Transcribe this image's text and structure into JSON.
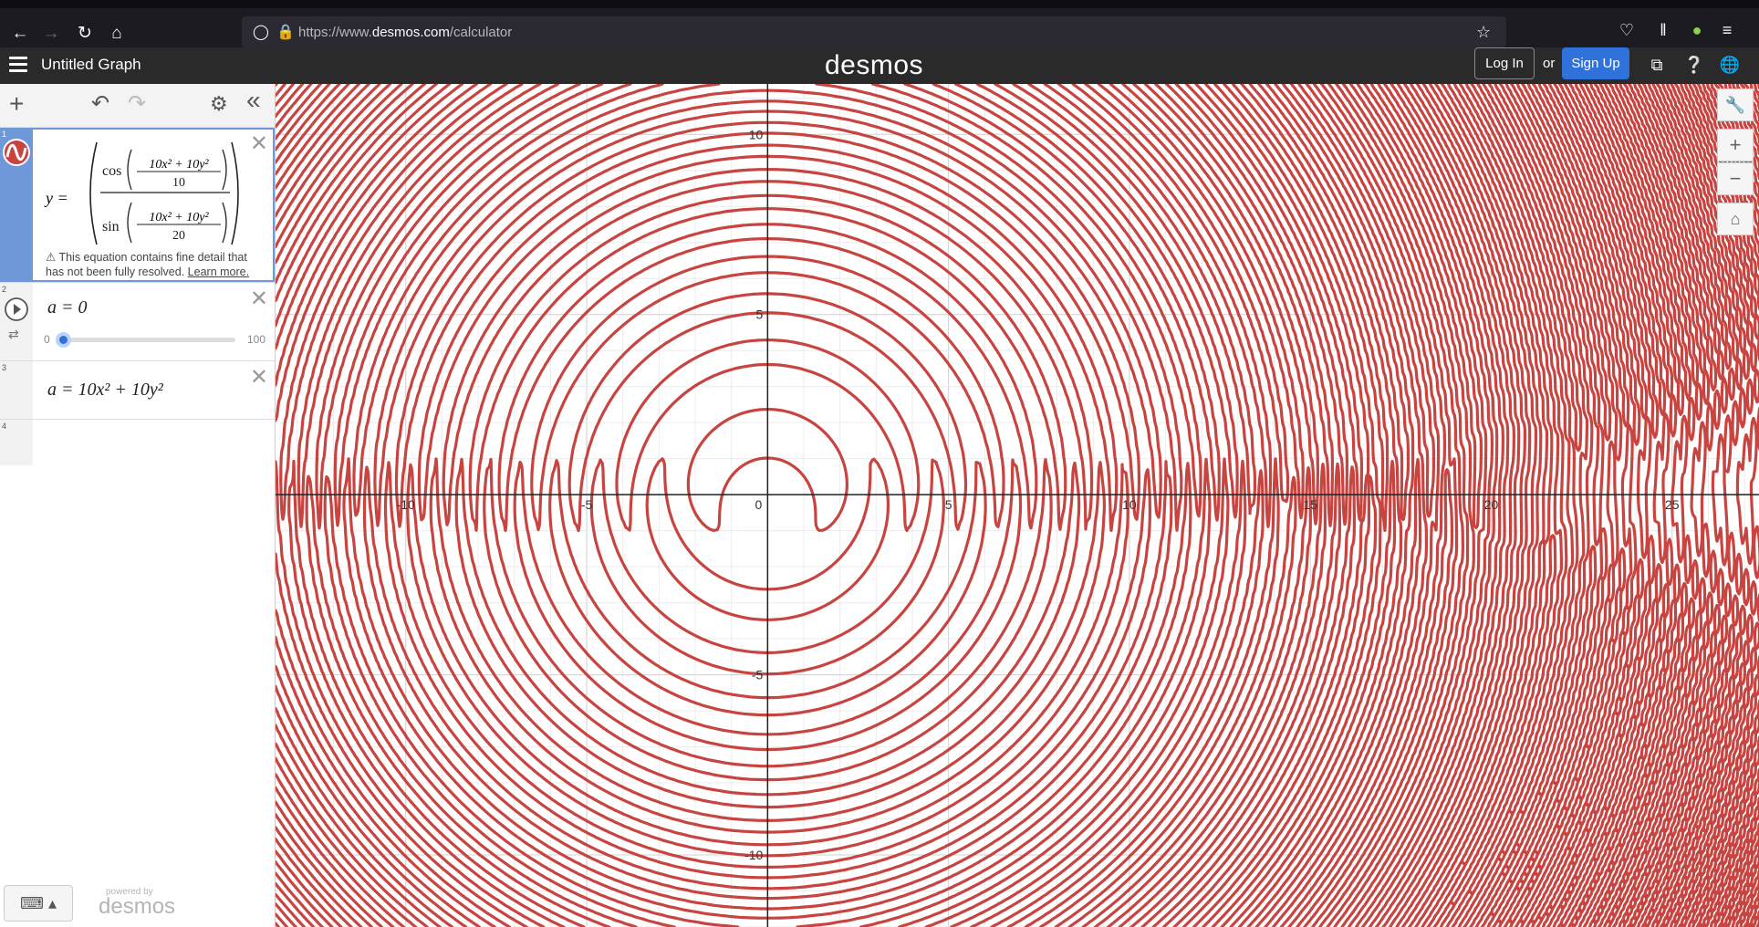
{
  "browser": {
    "url_prefix": "https://www.",
    "url_host": "desmos.com",
    "url_path": "/calculator"
  },
  "header": {
    "title": "Untitled Graph",
    "logo": "desmos",
    "login_label": "Log In",
    "or_label": "or",
    "signup_label": "Sign Up"
  },
  "expressions": [
    {
      "number": "1",
      "lhs": "y =",
      "cos_numerator": "10x² + 10y²",
      "cos_denominator": "10",
      "sin_numerator": "10x² + 10y²",
      "sin_denominator": "20",
      "color": "#c74440",
      "warning": "This equation contains fine detail that has not been fully resolved.",
      "warning_link": "Learn more."
    },
    {
      "number": "2",
      "text": "a = 0",
      "slider_min": "0",
      "slider_max": "100",
      "slider_value": 0
    },
    {
      "number": "3",
      "text": "a  =  10x² + 10y²"
    },
    {
      "number": "4"
    }
  ],
  "footer": {
    "powered_by": "powered by",
    "logo": "desmos"
  },
  "graph": {
    "x_ticks": [
      "-10",
      "-5",
      "0",
      "5",
      "10",
      "15",
      "20",
      "25"
    ],
    "y_ticks": [
      "10",
      "5",
      "-5",
      "-10"
    ],
    "curve_color": "#c74440",
    "x_range": [
      -13.6,
      27.4
    ],
    "y_range": [
      -12.0,
      11.4
    ]
  },
  "icons": {
    "back": "arrow-left-icon",
    "forward": "arrow-right-icon",
    "reload": "reload-icon",
    "home": "home-icon",
    "wrench": "wrench-icon",
    "zoom_in": "plus-icon",
    "zoom_out": "minus-icon",
    "default_view": "home-icon"
  }
}
